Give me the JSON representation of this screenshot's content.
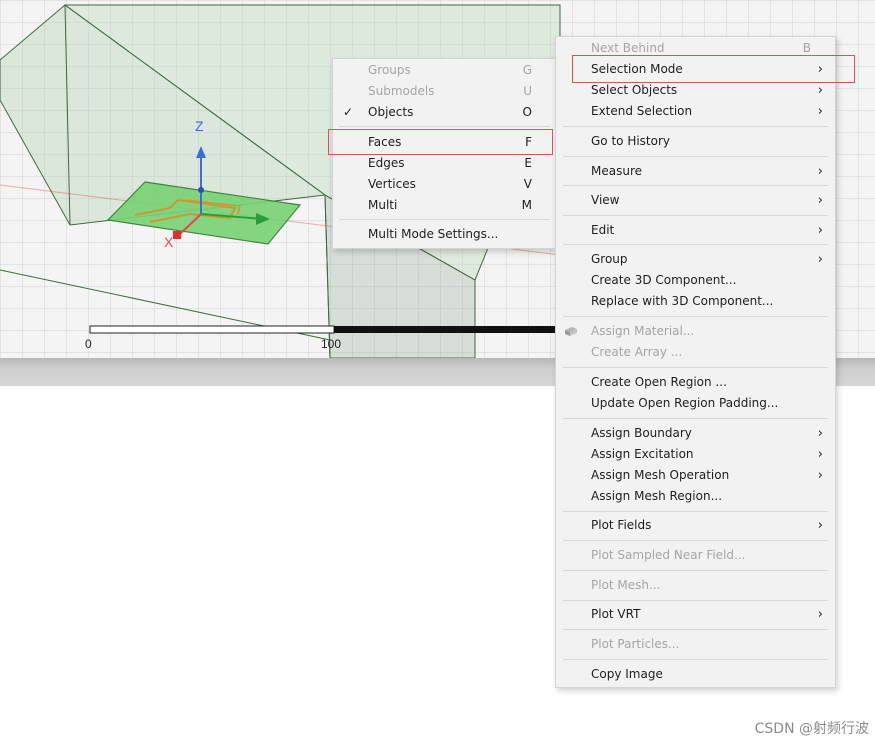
{
  "viewport": {
    "axis_z": "Z",
    "axis_x": "X",
    "scale_start": "0",
    "scale_end": "100"
  },
  "colors": {
    "menu_bg": "#f2f2f2",
    "highlight_border": "#d9534f",
    "disabled_text": "#a5a5a5",
    "model_fill": "#6fcf6a",
    "axis_z": "#3b6fd6",
    "axis_x": "#e14a4a",
    "axis_y": "#2a9d3a"
  },
  "submenu": {
    "items": [
      {
        "label": "Groups",
        "key": "G",
        "disabled": true,
        "checked": false
      },
      {
        "label": "Submodels",
        "key": "U",
        "disabled": true,
        "checked": false
      },
      {
        "label": "Objects",
        "key": "O",
        "disabled": false,
        "checked": true
      },
      {
        "label": "Faces",
        "key": "F",
        "disabled": false,
        "checked": false,
        "highlighted": true
      },
      {
        "label": "Edges",
        "key": "E",
        "disabled": false,
        "checked": false
      },
      {
        "label": "Vertices",
        "key": "V",
        "disabled": false,
        "checked": false
      },
      {
        "label": "Multi",
        "key": "M",
        "disabled": false,
        "checked": false
      },
      {
        "label": "Multi Mode Settings...",
        "key": "",
        "disabled": false,
        "checked": false
      }
    ],
    "check_mark": "✓"
  },
  "context_menu": {
    "items": [
      {
        "label": "Next Behind",
        "key": "B",
        "disabled": true
      },
      {
        "label": "Selection Mode",
        "submenu": true,
        "highlighted": true
      },
      {
        "label": "Select Objects",
        "submenu": true
      },
      {
        "label": "Extend Selection",
        "submenu": true
      },
      {
        "label": "Go to History"
      },
      {
        "label": "Measure",
        "submenu": true
      },
      {
        "label": "View",
        "submenu": true
      },
      {
        "label": "Edit",
        "submenu": true
      },
      {
        "label": "Group",
        "submenu": true
      },
      {
        "label": "Create 3D Component..."
      },
      {
        "label": "Replace with 3D Component..."
      },
      {
        "label": "Assign Material...",
        "disabled": true,
        "icon": "material-icon"
      },
      {
        "label": "Create Array ...",
        "disabled": true
      },
      {
        "label": "Create Open Region ..."
      },
      {
        "label": "Update Open Region Padding..."
      },
      {
        "label": "Assign Boundary",
        "submenu": true
      },
      {
        "label": "Assign Excitation",
        "submenu": true
      },
      {
        "label": "Assign Mesh Operation",
        "submenu": true
      },
      {
        "label": "Assign Mesh Region..."
      },
      {
        "label": "Plot Fields",
        "submenu": true
      },
      {
        "label": "Plot Sampled Near Field...",
        "disabled": true
      },
      {
        "label": "Plot Mesh...",
        "disabled": true
      },
      {
        "label": "Plot VRT",
        "submenu": true
      },
      {
        "label": "Plot Particles...",
        "disabled": true
      },
      {
        "label": "Copy Image"
      }
    ],
    "arrow_glyph": "›"
  },
  "watermark": "CSDN @射频行波"
}
